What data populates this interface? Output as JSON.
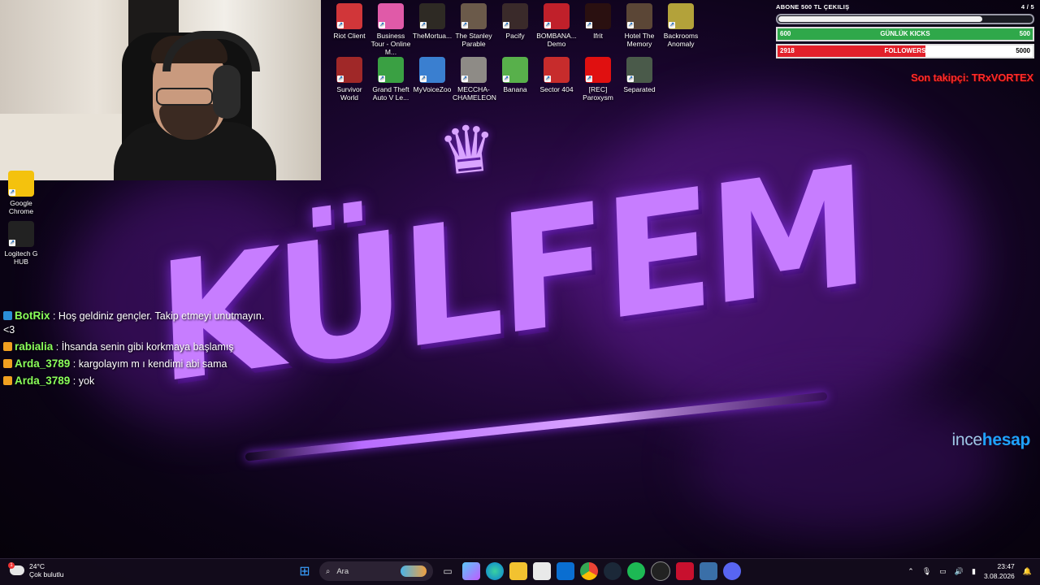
{
  "desktop_icons": {
    "row1": [
      {
        "label": "Riot Client",
        "color": "#d13639",
        "icon": "riot-icon"
      },
      {
        "label": "Business Tour - Online M...",
        "color": "#e05aa8",
        "icon": "business-tour-icon"
      },
      {
        "label": "TheMortua...",
        "color": "#2e2a24",
        "icon": "mortuary-icon"
      },
      {
        "label": "The Stanley Parable",
        "color": "#6b5a4a",
        "icon": "stanley-icon"
      },
      {
        "label": "Pacify",
        "color": "#3a2a2a",
        "icon": "pacify-icon"
      },
      {
        "label": "BOMBANA... Demo",
        "color": "#c0202a",
        "icon": "bombana-icon"
      },
      {
        "label": "Ifrit",
        "color": "#2a1010",
        "icon": "ifrit-icon"
      },
      {
        "label": "Hotel The Memory",
        "color": "#5b4636",
        "icon": "hotel-icon"
      },
      {
        "label": "Backrooms Anomaly",
        "color": "#b3a23a",
        "icon": "backrooms-icon"
      }
    ],
    "row2": [
      {
        "label": "Survivor World",
        "color": "#a02828",
        "icon": "survivor-icon"
      },
      {
        "label": "Grand Theft Auto V Le...",
        "color": "#3aa043",
        "icon": "gta-icon"
      },
      {
        "label": "MyVoiceZoo",
        "color": "#3a7fd0",
        "icon": "myvoicezoo-icon"
      },
      {
        "label": "MECCHA-CHAMELEON",
        "color": "#8e8b86",
        "icon": "meccha-icon"
      },
      {
        "label": "Banana",
        "color": "#58b04b",
        "icon": "banana-icon"
      },
      {
        "label": "Sector 404",
        "color": "#c72c2c",
        "icon": "sector-icon"
      },
      {
        "label": "[REC] Paroxysm",
        "color": "#e01010",
        "icon": "rec-icon"
      },
      {
        "label": "Separated",
        "color": "#4a5a4a",
        "icon": "separated-icon"
      }
    ],
    "left": [
      {
        "label": "Google Chrome",
        "color": "#f4c20d",
        "icon": "chrome-icon"
      },
      {
        "label": "Logitech G HUB",
        "color": "#222222",
        "icon": "logitech-icon"
      }
    ]
  },
  "overlay": {
    "goal_title": "ABONE 500 TL ÇEKILIŞ",
    "goal_count": "4 / 5",
    "goal_progress": 0.8,
    "kicks": {
      "left": "600",
      "label": "GÜNLÜK KICKS",
      "right": "500",
      "fill": 1.0,
      "color": "#2fa84a"
    },
    "followers": {
      "left": "2918",
      "label": "FOLLOWERS",
      "right": "5000",
      "fill": 0.58,
      "color": "#e2202a"
    },
    "last_follower": "Son takipçi: TRxVORTEX"
  },
  "logo": {
    "text": "KÜLFEM",
    "crown": "♛"
  },
  "brand": {
    "part1": "ince",
    "part2": "hesap"
  },
  "chat": [
    {
      "user": "BotRix",
      "text": ": Hoş geldiniz gençler. Takip etmeyi unutmayın. <3",
      "color": "#8aff5a"
    },
    {
      "user": "rabialia",
      "text": ": İhsanda senin gibi korkmaya başlamış",
      "color": "#8aff5a"
    },
    {
      "user": "Arda_3789",
      "text": ": kargolayım m ı kendimi abi sama",
      "color": "#8aff5a"
    },
    {
      "user": "Arda_3789",
      "text": ": yok",
      "color": "#8aff5a"
    }
  ],
  "taskbar": {
    "temp": "24°C",
    "weather": "Çok bulutlu",
    "weather_badge": "1",
    "search_placeholder": "Ara",
    "time": "23:47",
    "date": "3.08.2026"
  }
}
